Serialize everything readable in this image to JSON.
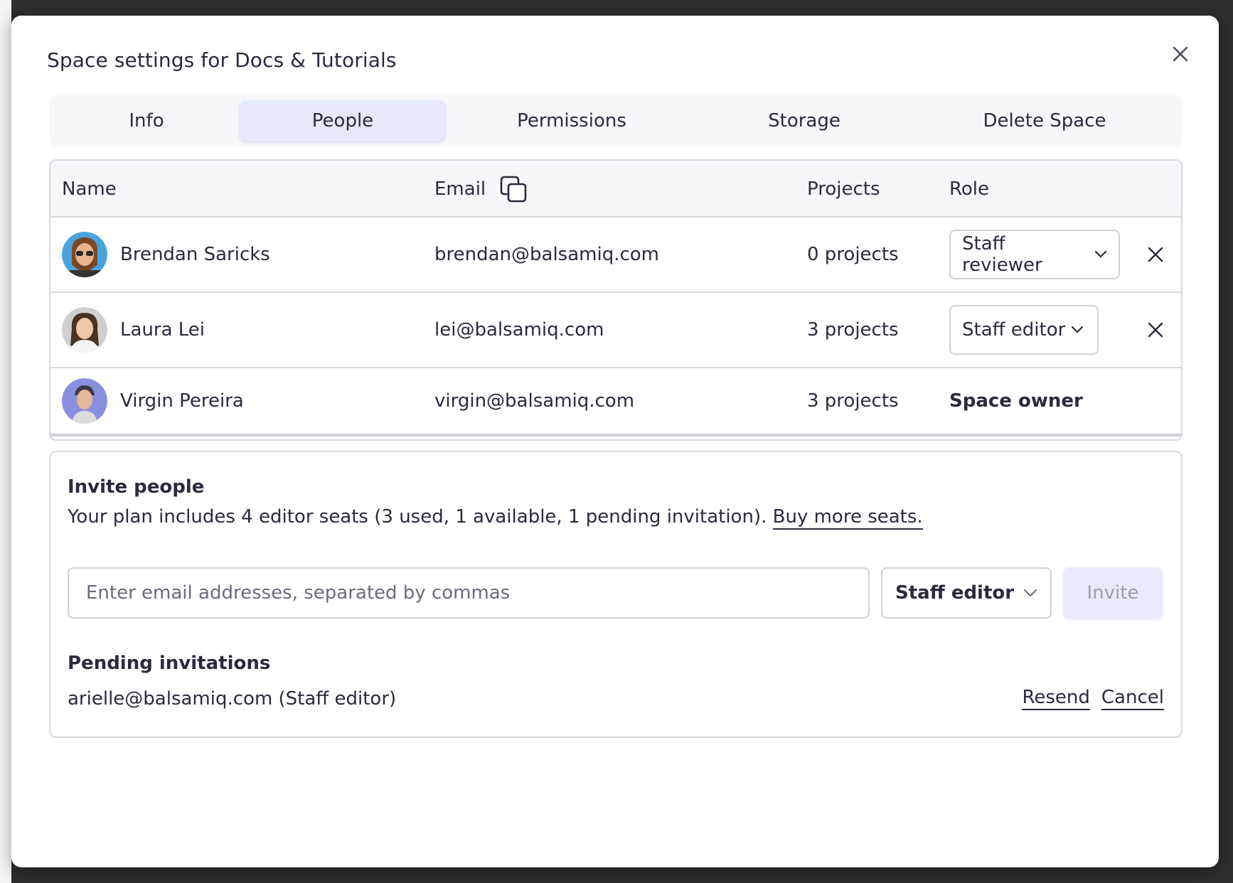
{
  "dialog": {
    "title": "Space settings for Docs & Tutorials",
    "close_icon": "close-icon"
  },
  "tabs": [
    {
      "label": "Info",
      "active": false
    },
    {
      "label": "People",
      "active": true
    },
    {
      "label": "Permissions",
      "active": false
    },
    {
      "label": "Storage",
      "active": false
    },
    {
      "label": "Delete Space",
      "active": false
    }
  ],
  "table": {
    "headers": {
      "name": "Name",
      "email": "Email",
      "projects": "Projects",
      "role": "Role"
    },
    "copy_icon": "copy-icon",
    "rows": [
      {
        "name": "Brendan Saricks",
        "email": "brendan@balsamiq.com",
        "projects": "0 projects",
        "role": "Staff reviewer",
        "removable": true,
        "avatar_color": "#4aa3df"
      },
      {
        "name": "Laura Lei",
        "email": "lei@balsamiq.com",
        "projects": "3 projects",
        "role": "Staff editor",
        "removable": true,
        "avatar_color": "#b8b8b8"
      },
      {
        "name": "Virgin Pereira",
        "email": "virgin@balsamiq.com",
        "projects": "3 projects",
        "role": "Space owner",
        "removable": false,
        "avatar_color": "#8a8fe0"
      }
    ]
  },
  "invite": {
    "title": "Invite people",
    "plan_text": "Your plan includes 4 editor seats (3 used, 1 available, 1 pending invitation). ",
    "buy_link": "Buy more seats.",
    "email_placeholder": "Enter email addresses, separated by commas",
    "email_value": "",
    "role_value": "Staff editor",
    "invite_button": "Invite"
  },
  "pending": {
    "title": "Pending invitations",
    "items": [
      {
        "text": "arielle@balsamiq.com (Staff editor)",
        "resend": "Resend",
        "cancel": "Cancel"
      }
    ]
  },
  "colors": {
    "text": "#2b2a3d",
    "tab_active_bg": "#e6e8fb",
    "invite_button_bg": "#e9ebfa",
    "border": "#d9d9e0"
  }
}
